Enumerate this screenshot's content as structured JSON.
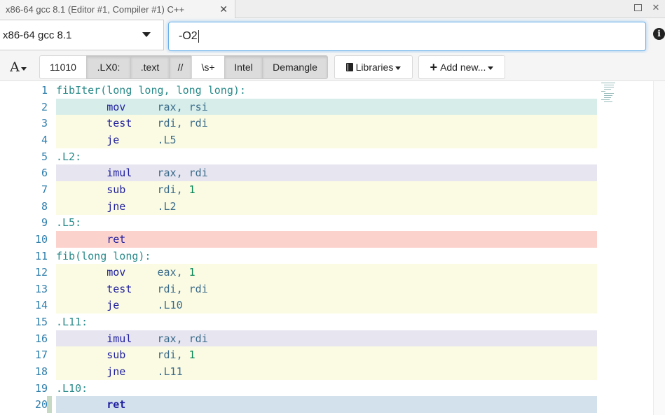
{
  "tab": {
    "title": "x86-64 gcc 8.1 (Editor #1, Compiler #1) C++",
    "close": "✕"
  },
  "window": {
    "maximize": "□",
    "close": "✕"
  },
  "compiler": {
    "selected": "x86-64 gcc 8.1",
    "options_value": "-O2",
    "info": "i"
  },
  "toolbar": {
    "font": "A",
    "filters": [
      {
        "label": "11010",
        "active": false
      },
      {
        "label": ".LX0:",
        "active": true
      },
      {
        "label": ".text",
        "active": true
      },
      {
        "label": "//",
        "active": true
      },
      {
        "label": "\\s+",
        "active": false
      },
      {
        "label": "Intel",
        "active": true
      },
      {
        "label": "Demangle",
        "active": true
      }
    ],
    "libraries": "Libraries",
    "add_new": "Add new..."
  },
  "code": {
    "lines": [
      {
        "num": "1",
        "label": "fibIter(long long, long long):",
        "mnem": "",
        "args": "",
        "hl": "none"
      },
      {
        "num": "2",
        "label": "",
        "mnem": "mov",
        "args": "rax, rsi",
        "hl": "mint"
      },
      {
        "num": "3",
        "label": "",
        "mnem": "test",
        "args": "rdi, rdi",
        "hl": "cream"
      },
      {
        "num": "4",
        "label": "",
        "mnem": "je",
        "args": ".L5",
        "hl": "cream"
      },
      {
        "num": "5",
        "label": ".L2:",
        "mnem": "",
        "args": "",
        "hl": "none"
      },
      {
        "num": "6",
        "label": "",
        "mnem": "imul",
        "args": "rax, rdi",
        "hl": "lav"
      },
      {
        "num": "7",
        "label": "",
        "mnem": "sub",
        "args": "rdi, 1",
        "hl": "cream"
      },
      {
        "num": "8",
        "label": "",
        "mnem": "jne",
        "args": ".L2",
        "hl": "cream"
      },
      {
        "num": "9",
        "label": ".L5:",
        "mnem": "",
        "args": "",
        "hl": "none"
      },
      {
        "num": "10",
        "label": "",
        "mnem": "ret",
        "args": "",
        "hl": "pink"
      },
      {
        "num": "11",
        "label": "fib(long long):",
        "mnem": "",
        "args": "",
        "hl": "none"
      },
      {
        "num": "12",
        "label": "",
        "mnem": "mov",
        "args": "eax, 1",
        "hl": "cream"
      },
      {
        "num": "13",
        "label": "",
        "mnem": "test",
        "args": "rdi, rdi",
        "hl": "cream"
      },
      {
        "num": "14",
        "label": "",
        "mnem": "je",
        "args": ".L10",
        "hl": "cream"
      },
      {
        "num": "15",
        "label": ".L11:",
        "mnem": "",
        "args": "",
        "hl": "none"
      },
      {
        "num": "16",
        "label": "",
        "mnem": "imul",
        "args": "rax, rdi",
        "hl": "lav"
      },
      {
        "num": "17",
        "label": "",
        "mnem": "sub",
        "args": "rdi, 1",
        "hl": "cream"
      },
      {
        "num": "18",
        "label": "",
        "mnem": "jne",
        "args": ".L11",
        "hl": "cream"
      },
      {
        "num": "19",
        "label": ".L10:",
        "mnem": "",
        "args": "",
        "hl": "none"
      },
      {
        "num": "20",
        "label": "",
        "mnem": "ret",
        "args": "",
        "hl": "blue"
      }
    ]
  },
  "colors": {
    "mint": "#d6ede9",
    "cream": "#fbfbe3",
    "lavender": "#e7e5f0",
    "pink": "#fcd2cc",
    "blue": "#d3e1ec"
  }
}
